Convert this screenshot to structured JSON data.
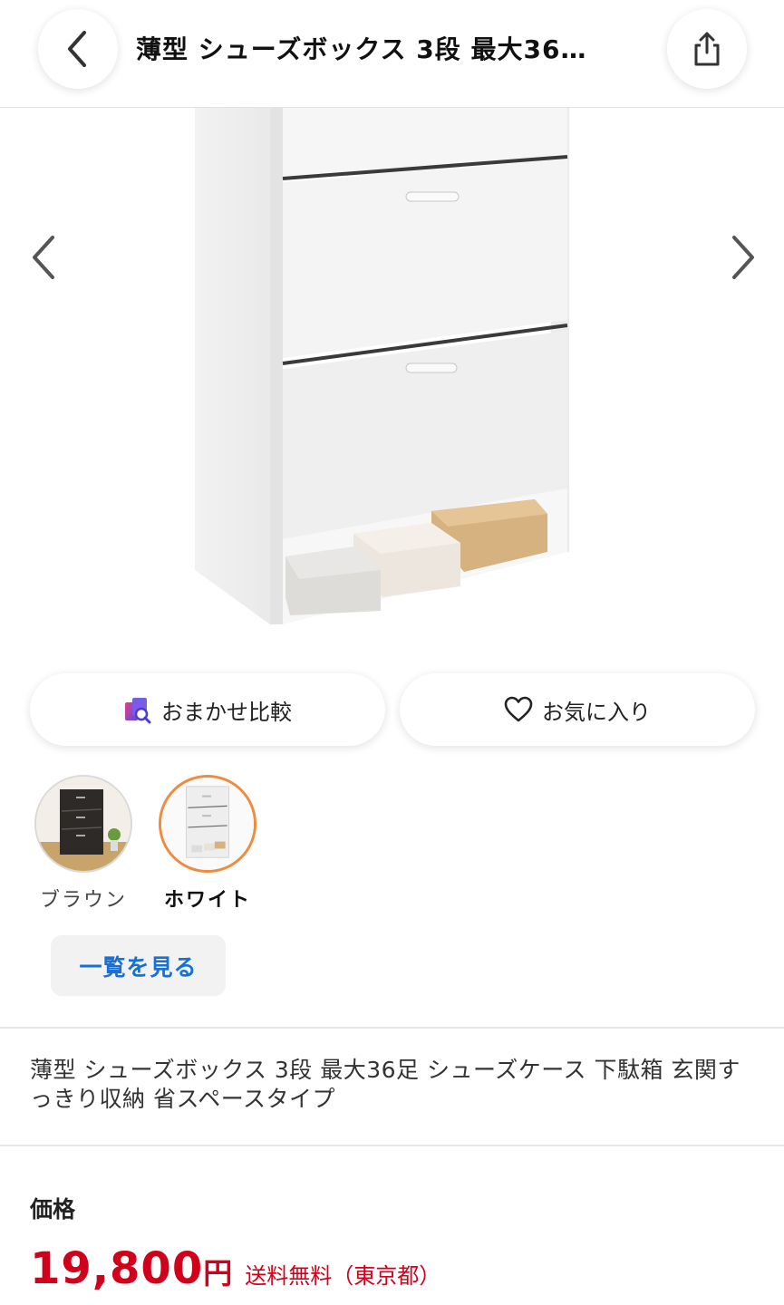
{
  "header": {
    "title": "薄型 シューズボックス 3段 最大36…"
  },
  "actions": {
    "compare_label": "おまかせ比較",
    "favorite_label": "お気に入り"
  },
  "variants": [
    {
      "label": "ブラウン",
      "selected": false
    },
    {
      "label": "ホワイト",
      "selected": true
    }
  ],
  "list_button": "一覧を見る",
  "description": "薄型 シューズボックス 3段 最大36足 シューズケース 下駄箱 玄関すっきり収納 省スペースタイプ",
  "price": {
    "label": "価格",
    "amount": "19,800",
    "unit": "円",
    "shipping": "送料無料（東京都）"
  },
  "colors": {
    "accent_orange": "#f08a3c",
    "link_blue": "#1a6fd3",
    "price_red": "#d0021b"
  }
}
